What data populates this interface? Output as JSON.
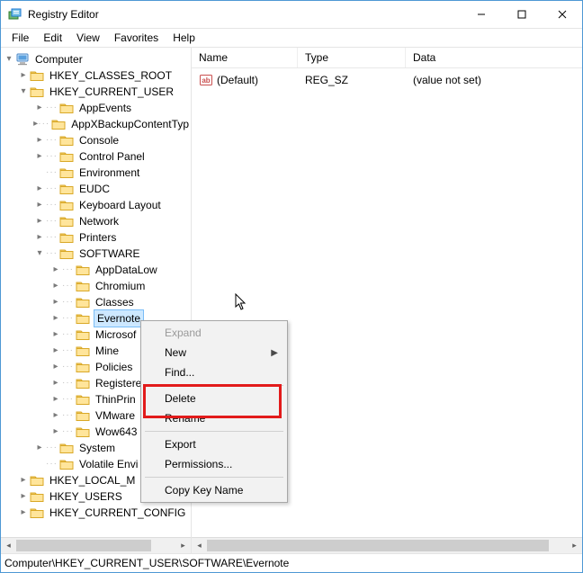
{
  "titlebar": {
    "title": "Registry Editor"
  },
  "menubar": {
    "items": [
      "File",
      "Edit",
      "View",
      "Favorites",
      "Help"
    ]
  },
  "tree": {
    "root": {
      "label": "Computer",
      "expander": "down"
    },
    "hives": [
      {
        "label": "HKEY_CLASSES_ROOT",
        "expander": "right",
        "dots": false
      },
      {
        "label": "HKEY_CURRENT_USER",
        "expander": "down",
        "dots": false,
        "children": [
          {
            "label": "AppEvents",
            "expander": "right",
            "dots": true
          },
          {
            "label": "AppXBackupContentTyp",
            "expander": "right",
            "dots": true
          },
          {
            "label": "Console",
            "expander": "right",
            "dots": true
          },
          {
            "label": "Control Panel",
            "expander": "right",
            "dots": true
          },
          {
            "label": "Environment",
            "expander": "none",
            "dots": true
          },
          {
            "label": "EUDC",
            "expander": "right",
            "dots": true
          },
          {
            "label": "Keyboard Layout",
            "expander": "right",
            "dots": true
          },
          {
            "label": "Network",
            "expander": "right",
            "dots": true
          },
          {
            "label": "Printers",
            "expander": "right",
            "dots": true
          },
          {
            "label": "SOFTWARE",
            "expander": "down",
            "dots": true,
            "children": [
              {
                "label": "AppDataLow",
                "expander": "right",
                "dots": true
              },
              {
                "label": "Chromium",
                "expander": "right",
                "dots": true
              },
              {
                "label": "Classes",
                "expander": "right",
                "dots": true
              },
              {
                "label": "Evernote",
                "expander": "right",
                "dots": true,
                "selected": true
              },
              {
                "label": "Microsof",
                "expander": "right",
                "dots": true
              },
              {
                "label": "Mine",
                "expander": "right",
                "dots": true
              },
              {
                "label": "Policies",
                "expander": "right",
                "dots": true
              },
              {
                "label": "Registere",
                "expander": "right",
                "dots": true
              },
              {
                "label": "ThinPrin",
                "expander": "right",
                "dots": true
              },
              {
                "label": "VMware",
                "expander": "right",
                "dots": true
              },
              {
                "label": "Wow643",
                "expander": "right",
                "dots": true
              }
            ]
          },
          {
            "label": "System",
            "expander": "right",
            "dots": true
          },
          {
            "label": "Volatile Envi",
            "expander": "none",
            "dots": true
          }
        ]
      },
      {
        "label": "HKEY_LOCAL_M",
        "expander": "right",
        "dots": false
      },
      {
        "label": "HKEY_USERS",
        "expander": "right",
        "dots": false
      },
      {
        "label": "HKEY_CURRENT_CONFIG",
        "expander": "right",
        "dots": false
      }
    ]
  },
  "list": {
    "headers": {
      "name": "Name",
      "type": "Type",
      "data": "Data"
    },
    "rows": [
      {
        "name": "(Default)",
        "type": "REG_SZ",
        "data": "(value not set)"
      }
    ]
  },
  "context_menu": {
    "items": [
      {
        "label": "Expand",
        "disabled": true
      },
      {
        "label": "New",
        "submenu": true
      },
      {
        "label": "Find..."
      },
      {
        "sep": true
      },
      {
        "label": "Delete"
      },
      {
        "label": "Rename"
      },
      {
        "sep": true
      },
      {
        "label": "Export"
      },
      {
        "label": "Permissions..."
      },
      {
        "sep": true
      },
      {
        "label": "Copy Key Name"
      }
    ]
  },
  "statusbar": {
    "path": "Computer\\HKEY_CURRENT_USER\\SOFTWARE\\Evernote"
  },
  "icons": {
    "app": "regedit-icon",
    "computer": "computer-icon",
    "folder": "folder-icon",
    "value_string": "string-value-icon"
  }
}
